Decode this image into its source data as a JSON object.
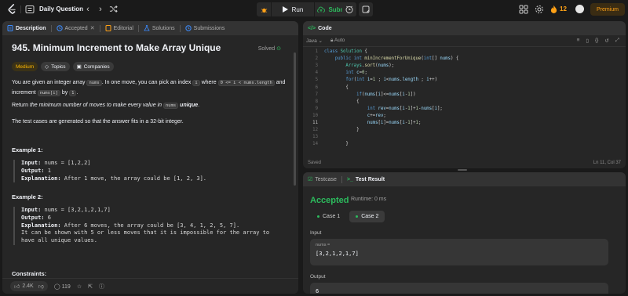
{
  "topbar": {
    "title": "Daily Question",
    "run_label": "Run",
    "submit_label": "Submit",
    "streak": "12",
    "premium_label": "Premium"
  },
  "tabs": [
    {
      "label": "Description"
    },
    {
      "label": "Accepted"
    },
    {
      "label": "Editorial"
    },
    {
      "label": "Solutions"
    },
    {
      "label": "Submissions"
    }
  ],
  "problem": {
    "title": "945. Minimum Increment to Make Array Unique",
    "status": "Solved",
    "difficulty": "Medium",
    "topics_label": "Topics",
    "companies_label": "Companies",
    "p1_a": "You are given an integer array ",
    "p1_code1": "nums",
    "p1_b": ". In one move, you can pick an index ",
    "p1_code2": "i",
    "p1_c": " where ",
    "p1_code3": "0 <= i < nums.length",
    "p1_d": " and increment ",
    "p1_code4": "nums[i]",
    "p1_e": " by ",
    "p1_code5": "1",
    "p1_f": ".",
    "p2_a": "Return ",
    "p2_em": "the minimum number of moves to make every value in ",
    "p2_code": "nums",
    "p2_strong": " unique",
    "p2_end": ".",
    "p3": "The test cases are generated so that the answer fits in a 32-bit integer.",
    "ex1_title": "Example 1:",
    "ex1_input_k": "Input:",
    "ex1_input_v": " nums = [1,2,2]",
    "ex1_output_k": "Output:",
    "ex1_output_v": " 1",
    "ex1_expl_k": "Explanation:",
    "ex1_expl_v": " After 1 move, the array could be [1, 2, 3].",
    "ex2_title": "Example 2:",
    "ex2_input_k": "Input:",
    "ex2_input_v": " nums = [3,2,1,2,1,7]",
    "ex2_output_k": "Output:",
    "ex2_output_v": " 6",
    "ex2_expl_k": "Explanation:",
    "ex2_expl_v": " After 6 moves, the array could be [3, 4, 1, 2, 5, 7].",
    "ex2_line4": "It can be shown with 5 or less moves that it is impossible for the array to",
    "ex2_line5": "have all unique values.",
    "constraints": "Constraints:",
    "likes": "2.4K",
    "comments": "119"
  },
  "code_panel": {
    "title": "Code",
    "language": "Java",
    "auto": "Auto",
    "saved": "Saved",
    "cursor": "Ln 11, Col 37",
    "line_numbers": [
      "1",
      "2",
      "3",
      "4",
      "5",
      "6",
      "7",
      "8",
      "9",
      "10",
      "11",
      "12",
      "13",
      "14"
    ]
  },
  "result_panel": {
    "testcase_tab": "Testcase",
    "result_tab": "Test Result",
    "status": "Accepted",
    "runtime": "Runtime: 0 ms",
    "case1": "Case 1",
    "case2": "Case 2",
    "input_label": "Input",
    "input_var": "nums =",
    "input_value": "[3,2,1,2,1,7]",
    "output_label": "Output",
    "output_value": "6"
  },
  "colors": {
    "accent_green": "#2cbb5d",
    "accent_orange": "#ffa116",
    "medium": "#ffb800"
  }
}
